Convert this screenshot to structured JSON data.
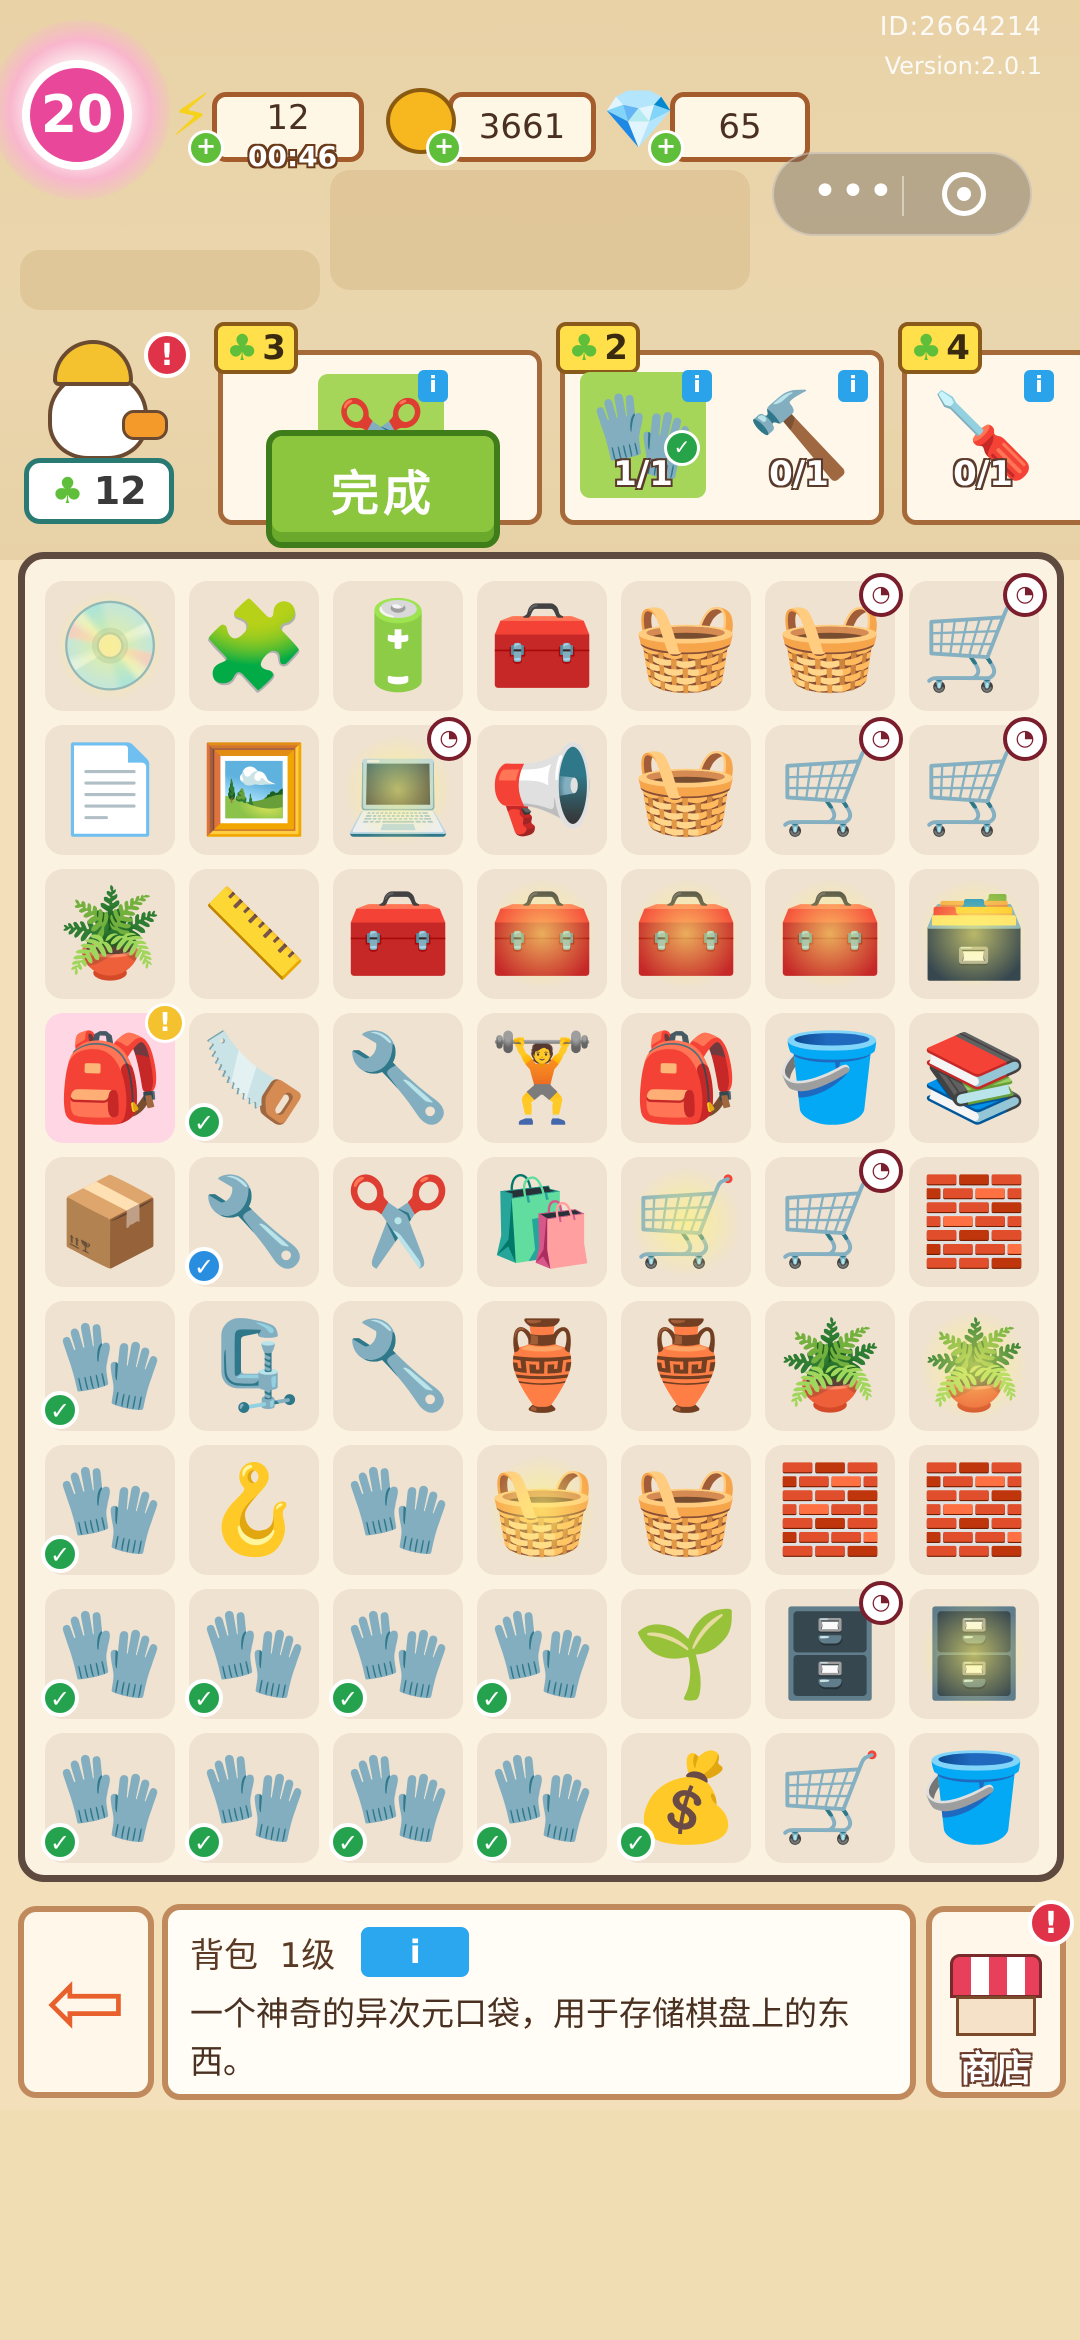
{
  "header": {
    "player_id": "ID:2664214",
    "version": "Version:2.0.1",
    "level": "20",
    "energy": "12",
    "energy_timer": "00:46",
    "coins": "3661",
    "gems": "65"
  },
  "capsule": {
    "more_icon": "more-dots-icon",
    "close_icon": "target-icon"
  },
  "character": {
    "stars": "12"
  },
  "orders": [
    {
      "reward": "3",
      "items": [
        {
          "icon": "hedge-trimmer-icon",
          "progress": ""
        }
      ],
      "complete_label": "完成"
    },
    {
      "reward": "2",
      "items": [
        {
          "icon": "gloves-icon",
          "progress": "1/1"
        },
        {
          "icon": "hammer-icon",
          "progress": "0/1"
        }
      ]
    },
    {
      "reward": "4",
      "items": [
        {
          "icon": "drill-icon",
          "progress": "0/1"
        }
      ]
    }
  ],
  "board": {
    "rows": [
      [
        {
          "e": "💿",
          "n": "cd-player-icon",
          "s": 1
        },
        {
          "e": "🧩",
          "n": "circuit-board-icon"
        },
        {
          "e": "🔋",
          "n": "capacitor-icon"
        },
        {
          "e": "🧰",
          "n": "tool-box-icon"
        },
        {
          "e": "🧺",
          "n": "red-basket-icon"
        },
        {
          "e": "🧺",
          "n": "tool-basket-icon",
          "t": 1
        },
        {
          "e": "🛒",
          "n": "wheelbarrow-icon",
          "t": 1
        }
      ],
      [
        {
          "e": "📄",
          "n": "booklet-icon"
        },
        {
          "e": "🖼️",
          "n": "poster-icon"
        },
        {
          "e": "💻",
          "n": "laptop-icon",
          "t": 1,
          "s": 1
        },
        {
          "e": "📢",
          "n": "megaphone-icon"
        },
        {
          "e": "🧺",
          "n": "yellow-basket-icon"
        },
        {
          "e": "🛒",
          "n": "yellow-cart-icon",
          "t": 1
        },
        {
          "e": "🛒",
          "n": "tool-cart-icon",
          "t": 1
        }
      ],
      [
        {
          "e": "🪴",
          "n": "potted-tree-icon"
        },
        {
          "e": "📏",
          "n": "tape-measure-icon"
        },
        {
          "e": "🧰",
          "n": "green-toolbox-icon"
        },
        {
          "e": "🧰",
          "n": "open-toolbox-icon",
          "s": 1
        },
        {
          "e": "🧰",
          "n": "toolbox-tools-icon",
          "s": 1
        },
        {
          "e": "🧰",
          "n": "full-toolbox-icon",
          "s": 1
        },
        {
          "e": "🗃️",
          "n": "toolbox-chest-icon",
          "s": 1
        }
      ],
      [
        {
          "e": "🎒",
          "n": "backpack-icon",
          "a": 1,
          "sel": 1
        },
        {
          "e": "🪚",
          "n": "hacksaw-icon",
          "c": 1
        },
        {
          "e": "🔧",
          "n": "pipe-wrench-icon"
        },
        {
          "e": "🏋️",
          "n": "dumbbell-icon"
        },
        {
          "e": "🎒",
          "n": "black-bag-icon"
        },
        {
          "e": "🪣",
          "n": "paint-bucket-icon"
        },
        {
          "e": "📚",
          "n": "catalog-icon"
        }
      ],
      [
        {
          "e": "📦",
          "n": "box-icon"
        },
        {
          "e": "🔧",
          "n": "adjustable-wrench-icon",
          "cb": 1
        },
        {
          "e": "✂️",
          "n": "pliers-icon"
        },
        {
          "e": "🛍️",
          "n": "paper-bag-icon"
        },
        {
          "e": "🛒",
          "n": "shopping-cart-icon",
          "s": 1
        },
        {
          "e": "🛒",
          "n": "box-cart-icon",
          "t": 1
        },
        {
          "e": "🧱",
          "n": "sandbags-icon"
        }
      ],
      [
        {
          "e": "🧤",
          "n": "gloves-icon",
          "c": 1
        },
        {
          "e": "🗜️",
          "n": "wire-cutter-icon"
        },
        {
          "e": "🔧",
          "n": "green-wrench-icon"
        },
        {
          "e": "🏺",
          "n": "broken-pot-icon"
        },
        {
          "e": "🏺",
          "n": "cracked-pot-icon"
        },
        {
          "e": "🪴",
          "n": "clay-pot-icon"
        },
        {
          "e": "🪴",
          "n": "soil-pot-icon",
          "s": 1
        }
      ],
      [
        {
          "e": "🧤",
          "n": "gloves-icon",
          "c": 1
        },
        {
          "e": "🪝",
          "n": "hook-icon"
        },
        {
          "e": "🧤",
          "n": "glove-icon"
        },
        {
          "e": "🧺",
          "n": "wicker-basket-icon",
          "s": 1
        },
        {
          "e": "🧺",
          "n": "wicker-basket-icon"
        },
        {
          "e": "🧱",
          "n": "pink-bricks-icon"
        },
        {
          "e": "🧱",
          "n": "brick-stack-icon"
        }
      ],
      [
        {
          "e": "🧤",
          "n": "gloves-icon",
          "c": 1
        },
        {
          "e": "🧤",
          "n": "gloves-icon",
          "c": 1
        },
        {
          "e": "🧤",
          "n": "gloves-icon",
          "c": 1
        },
        {
          "e": "🧤",
          "n": "gloves-icon",
          "c": 1
        },
        {
          "e": "🌱",
          "n": "sprout-pot-icon"
        },
        {
          "e": "🗄️",
          "n": "drawer-cabinet-icon",
          "t": 1
        },
        {
          "e": "🗄️",
          "n": "drawer-chest-icon",
          "s": 1
        }
      ],
      [
        {
          "e": "🧤",
          "n": "gloves-icon",
          "c": 1
        },
        {
          "e": "🧤",
          "n": "gloves-icon",
          "c": 1
        },
        {
          "e": "🧤",
          "n": "gloves-icon",
          "c": 1
        },
        {
          "e": "🧤",
          "n": "gloves-icon",
          "c": 1
        },
        {
          "e": "💰",
          "n": "sack-icon",
          "c": 1
        },
        {
          "e": "🛒",
          "n": "purple-cart-icon"
        },
        {
          "e": "🪣",
          "n": "yellow-bucket-icon"
        }
      ]
    ]
  },
  "info_panel": {
    "title": "背包  1级",
    "info_button": "i",
    "description": "一个神奇的异次元口袋，用于存储棋盘上的东西。"
  },
  "shop": {
    "label": "商店"
  },
  "colors": {
    "board_border": "#5e4a3e",
    "cell": "#efe2d0",
    "accent_green": "#8cc63f",
    "info_blue": "#2aa7ee",
    "level_pink": "#e9489a"
  }
}
